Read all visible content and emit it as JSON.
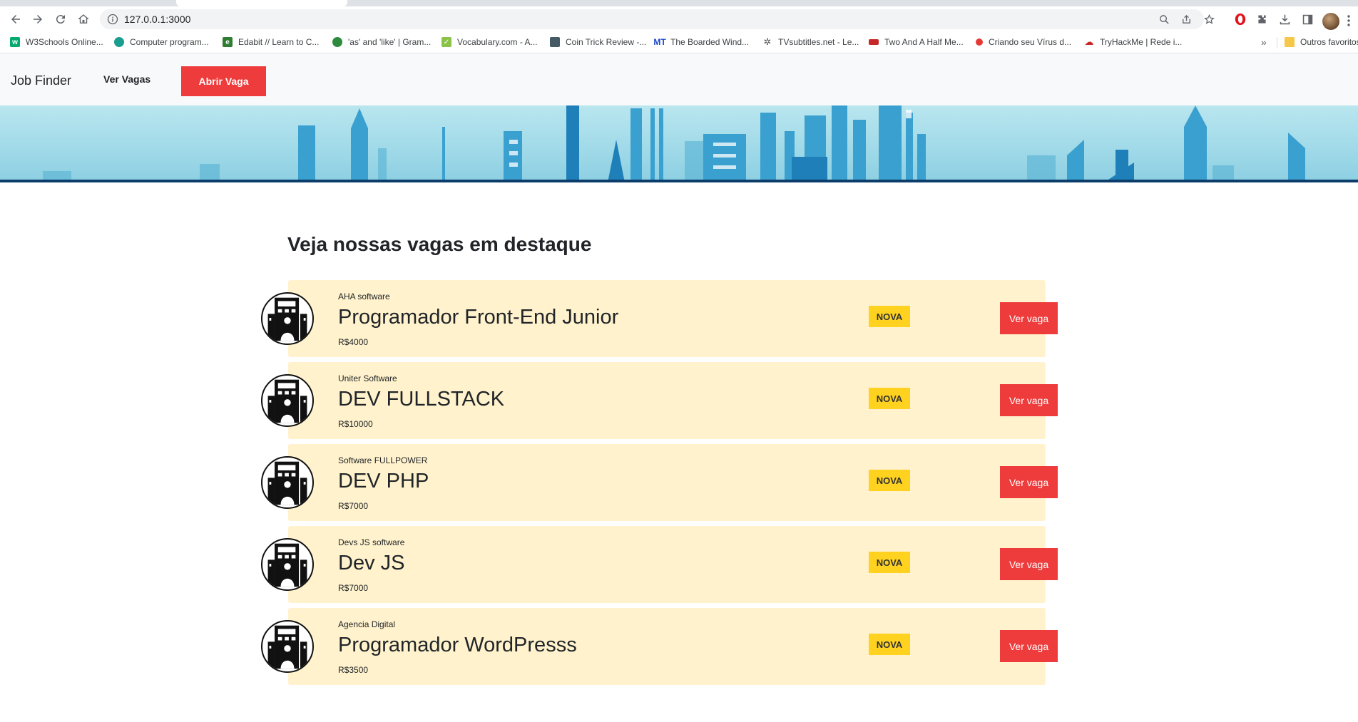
{
  "browser": {
    "url": "127.0.0.1:3000",
    "bookmarks": [
      {
        "label": "W3Schools Online...",
        "icon": "w3schools-icon",
        "color": "#04aa6d"
      },
      {
        "label": "Computer program...",
        "icon": "hexagon-icon",
        "color": "#1a9e8f"
      },
      {
        "label": "Edabit // Learn to C...",
        "icon": "edabit-icon",
        "color": "#2e7d32"
      },
      {
        "label": "'as' and 'like' | Gram...",
        "icon": "clover-icon",
        "color": "#2e8b3d"
      },
      {
        "label": "Vocabulary.com - A...",
        "icon": "check-icon",
        "color": "#8bc34a"
      },
      {
        "label": "Coin Trick Review -...",
        "icon": "coin-icon",
        "color": "#455a64"
      },
      {
        "label": "The Boarded Wind...",
        "icon": "mt-icon",
        "color": "#1a47c9"
      },
      {
        "label": "TVsubtitles.net - Le...",
        "icon": "gear-icon",
        "color": "#555555"
      },
      {
        "label": "Two And A Half Me...",
        "icon": "tv-icon",
        "color": "#c62828"
      },
      {
        "label": "Criando seu Vírus d...",
        "icon": "virus-icon",
        "color": "#e53935"
      },
      {
        "label": "TryHackMe | Rede i...",
        "icon": "cloud-icon",
        "color": "#c62828"
      }
    ],
    "bookmarks_more": "»",
    "other_bookmarks": "Outros favoritos"
  },
  "navbar": {
    "brand": "Job Finder",
    "link": "Ver Vagas",
    "cta": "Abrir Vaga"
  },
  "section_title": "Veja nossas vagas em destaque",
  "jobs": [
    {
      "company": "AHA software",
      "title": "Programador Front-End Junior",
      "salary": "R$4000",
      "badge": "NOVA",
      "button": "Ver vaga"
    },
    {
      "company": "Uniter Software",
      "title": "DEV FULLSTACK",
      "salary": "R$10000",
      "badge": "NOVA",
      "button": "Ver vaga"
    },
    {
      "company": "Software FULLPOWER",
      "title": "DEV PHP",
      "salary": "R$7000",
      "badge": "NOVA",
      "button": "Ver vaga"
    },
    {
      "company": "Devs JS software",
      "title": "Dev JS",
      "salary": "R$7000",
      "badge": "NOVA",
      "button": "Ver vaga"
    },
    {
      "company": "Agencia Digital",
      "title": "Programador WordPresss",
      "salary": "R$3500",
      "badge": "NOVA",
      "button": "Ver vaga"
    }
  ],
  "colors": {
    "accent_red": "#ee3b3b",
    "badge_yellow": "#ffd21f",
    "card_bg": "#fff2cc",
    "navbar_bg": "#f8f9fa",
    "hero_line": "#0c3d6a"
  }
}
